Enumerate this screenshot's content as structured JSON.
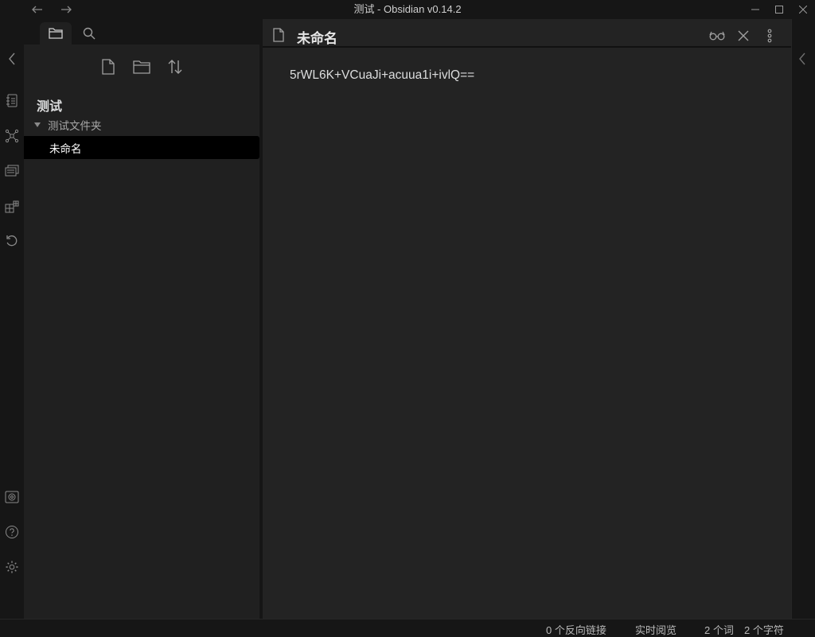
{
  "window": {
    "title": "测试 - Obsidian v0.14.2"
  },
  "sidebar": {
    "tabs": [
      {
        "name": "file-explorer",
        "icon": "folder-icon"
      },
      {
        "name": "search",
        "icon": "search-icon"
      }
    ],
    "nav_actions": [
      "new-note-icon",
      "new-folder-icon",
      "sort-icon"
    ],
    "vault_name": "测试",
    "folder": {
      "label": "测试文件夹",
      "expanded": true
    },
    "files": [
      {
        "label": "未命名",
        "active": true
      }
    ]
  },
  "ribbon": {
    "top_icons": [
      "open-quick-switcher-icon",
      "graph-view-icon",
      "slides-icon",
      "canvas-grid-icon",
      "history-icon"
    ],
    "bottom_icons": [
      "vault-icon",
      "help-icon",
      "settings-icon"
    ]
  },
  "editor": {
    "title": "未命名",
    "content": "5rWL6K+VCuaJi+acuua1i+ivlQ==",
    "actions": [
      "reading-view-icon",
      "close-icon",
      "more-options-icon"
    ]
  },
  "statusbar": {
    "backlinks": "0 个反向链接",
    "mode": "实时阅览",
    "words": "2 个词",
    "chars": "2 个字符"
  },
  "colors": {
    "background": "#161616",
    "sidebar": "#202020",
    "editor": "#232323",
    "active_file": "#000000",
    "text": "#dcddde"
  }
}
